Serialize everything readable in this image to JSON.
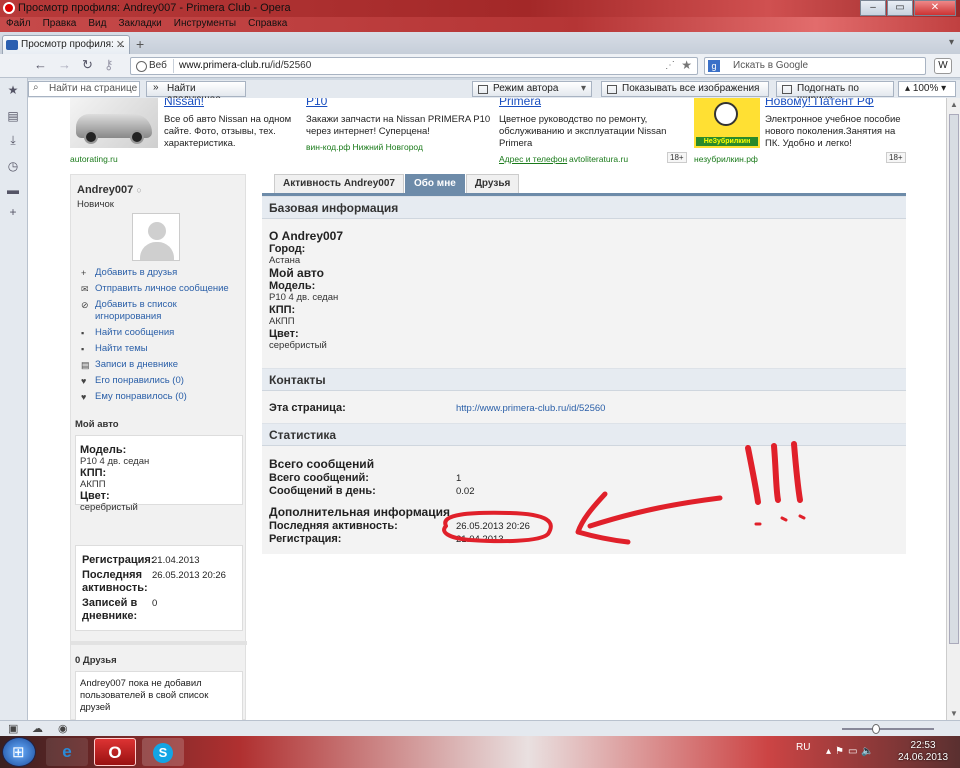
{
  "window": {
    "title": "Просмотр профиля: Andrey007 - Primera Club - Opera"
  },
  "menu": [
    "Файл",
    "Правка",
    "Вид",
    "Закладки",
    "Инструменты",
    "Справка"
  ],
  "tab": {
    "label": "Просмотр профиля: ..."
  },
  "address": {
    "mode": "Веб",
    "url_host": "www.primera-club.ru",
    "url_path": "/id/52560",
    "search_placeholder": "Искать в Google"
  },
  "toolbar": {
    "find_placeholder": "Найти на странице",
    "find_next": "Найти следующее",
    "author_mode": "Режим автора",
    "show_images": "Показывать все изображения",
    "fit_width": "Подогнать по ширине",
    "zoom": "100%"
  },
  "ads": [
    {
      "title": "Nissan!",
      "desc": "Все об авто Nissan на одном сайте. Фото, отзывы, тех. характеристика.",
      "source": "autorating.ru"
    },
    {
      "title": "P10",
      "desc": "Закажи запчасти на Nissan PRIMERA P10 через интернет! Суперцена!",
      "source": "вин-код.рф Нижний Новгород"
    },
    {
      "title": "Primera",
      "desc": "Цветное руководство по ремонту, обслуживанию и эксплуатации Nissan Primera",
      "source_link": "Адрес и телефон",
      "source": "avtoliteratura.ru",
      "age": "18+"
    },
    {
      "title": "Новому! Патент РФ",
      "desc": "Электронное учебное пособие нового поколения.Занятия на ПК. Удобно и легко!",
      "source": "незубрилкин.рф",
      "age": "18+",
      "logo_text": "НеЗубрилкин"
    }
  ],
  "profile": {
    "username": "Andrey007",
    "status_mark": "○",
    "rank": "Новичок",
    "actions": [
      {
        "icon": "+",
        "label": "Добавить в друзья"
      },
      {
        "icon": "✉",
        "label": "Отправить личное сообщение"
      },
      {
        "icon": "⊘",
        "label": "Добавить в список игнорирования"
      },
      {
        "icon": "▪",
        "label": "Найти сообщения"
      },
      {
        "icon": "▪",
        "label": "Найти темы"
      },
      {
        "icon": "▤",
        "label": "Записи в дневнике"
      },
      {
        "icon": "♥",
        "label": "Его понравились (0)"
      },
      {
        "icon": "♥",
        "label": "Ему понравилось (0)"
      }
    ],
    "my_car_title": "Мой авто",
    "car": {
      "model_label": "Модель:",
      "model": "P10 4 дв. седан",
      "gearbox_label": "КПП:",
      "gearbox": "АКПП",
      "color_label": "Цвет:",
      "color": "серебристый"
    },
    "reg": {
      "reg_label": "Регистрация:",
      "reg_value": "21.04.2013",
      "last_label": "Последняя активность:",
      "last_value": "26.05.2013 20:26",
      "diary_label": "Записей в дневнике:",
      "diary_value": "0"
    },
    "friends_title": "0 Друзья",
    "friends_text": "Andrey007 пока не добавил пользователей в свой список друзей"
  },
  "tabs": [
    "Активность Andrey007",
    "Обо мне",
    "Друзья"
  ],
  "about": {
    "basic_header": "Базовая информация",
    "about_title": "О Andrey007",
    "city_label": "Город:",
    "city": "Астана",
    "my_car": "Мой авто",
    "model_label": "Модель:",
    "model": "P10 4 дв. седан",
    "gearbox_label": "КПП:",
    "gearbox": "АКПП",
    "color_label": "Цвет:",
    "color": "серебристый",
    "contacts_header": "Контакты",
    "page_label": "Эта страница:",
    "page_url": "http://www.primera-club.ru/id/52560",
    "stats_header": "Статистика",
    "total_posts_title": "Всего сообщений",
    "total_posts_label": "Всего сообщений:",
    "total_posts": "1",
    "per_day_label": "Сообщений в день:",
    "per_day": "0.02",
    "extra_title": "Дополнительная информация",
    "last_label": "Последняя активность:",
    "last_value": "26.05.2013 20:26",
    "reg_label": "Регистрация:",
    "reg_value": "21.04.2013"
  },
  "annotation": {
    "marks": "!!!",
    "color": "#e0202a"
  },
  "taskbar": {
    "lang": "RU",
    "time": "22:53",
    "date": "24.06.2013"
  }
}
